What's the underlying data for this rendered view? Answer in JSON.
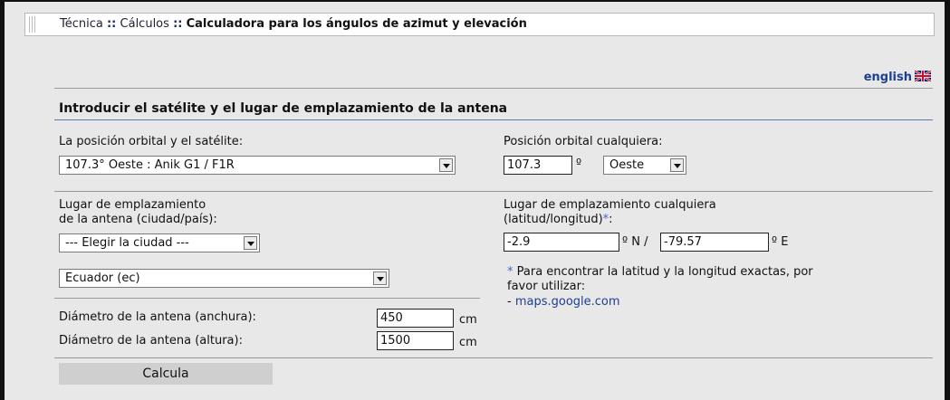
{
  "breadcrumb": {
    "items": [
      "Técnica",
      "Cálculos"
    ],
    "separator": "::",
    "current": "Calculadora para los ángulos de azimut y elevación"
  },
  "language_link": "english",
  "section_title": "Introducir el satélite y el lugar de emplazamiento de la antena",
  "satellite": {
    "label": "La posición orbital y el satélite:",
    "selected": "107.3° Oeste : Anik G1 / F1R"
  },
  "orbital": {
    "label": "Posición orbital cualquiera:",
    "value": "107.3",
    "unit": "º",
    "direction": "Oeste"
  },
  "location": {
    "label_line1": "Lugar de emplazamiento",
    "label_line2": "de la antena (ciudad/país):",
    "city_selected": "--- Elegir la ciudad ---",
    "country_selected": "Ecuador (ec)"
  },
  "coords": {
    "label_line1": "Lugar de emplazamiento cualquiera",
    "label_line2": "(latitud/longitud)",
    "star": "*",
    "colon": ":",
    "lat_value": "-2.9",
    "lat_unit": "º N /",
    "lon_value": "-79.57",
    "lon_unit": "º E",
    "note_line1": "Para encontrar la latitud y la longitud exactas, por",
    "note_line2": "favor utilizar:",
    "link_prefix": "- ",
    "link": "maps.google.com"
  },
  "dish": {
    "width_label": "Diámetro de la antena (anchura):",
    "width_value": "450",
    "height_label": "Diámetro de la antena (altura):",
    "height_value": "1500",
    "unit": "cm"
  },
  "calc_button": "Calcula",
  "colors": {
    "link": "#1d3f91",
    "accent_line": "#5a78b0",
    "background": "#e8e8e8"
  }
}
